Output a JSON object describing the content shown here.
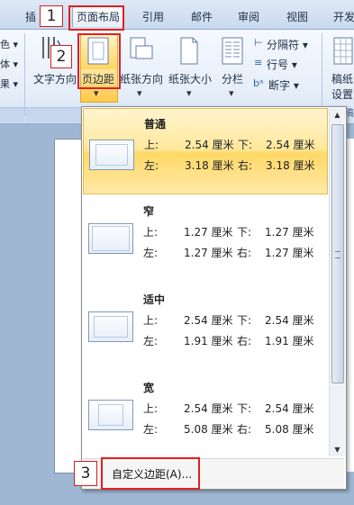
{
  "tabs": [
    {
      "label": "插",
      "active": false
    },
    {
      "label": "页面布局",
      "active": true
    },
    {
      "label": "引用",
      "active": false
    },
    {
      "label": "邮件",
      "active": false
    },
    {
      "label": "审阅",
      "active": false
    },
    {
      "label": "视图",
      "active": false
    },
    {
      "label": "开发",
      "active": false
    }
  ],
  "ribbon": {
    "left_labels": [
      "色 ▾",
      "体 ▾",
      "果 ▾"
    ],
    "text_direction": "文字方向",
    "margins": "页边距",
    "orientation": "纸张方向",
    "size": "纸张大小",
    "columns": "分栏",
    "breaks": "分隔符 ▾",
    "line_numbers": "行号 ▾",
    "hyphenation": "断字 ▾",
    "draft_line1": "稿纸",
    "draft_line2": "设置",
    "draft_group": "稿"
  },
  "margin_presets": [
    {
      "name": "普通",
      "top_label": "上:",
      "top": "2.54 厘米",
      "bottom_label": "下:",
      "bottom": "2.54 厘米",
      "left_label": "左:",
      "left": "3.18 厘米",
      "right_label": "右:",
      "right": "3.18 厘米",
      "selected": true
    },
    {
      "name": "窄",
      "top_label": "上:",
      "top": "1.27 厘米",
      "bottom_label": "下:",
      "bottom": "1.27 厘米",
      "left_label": "左:",
      "left": "1.27 厘米",
      "right_label": "右:",
      "right": "1.27 厘米",
      "selected": false
    },
    {
      "name": "适中",
      "top_label": "上:",
      "top": "2.54 厘米",
      "bottom_label": "下:",
      "bottom": "2.54 厘米",
      "left_label": "左:",
      "left": "1.91 厘米",
      "right_label": "右:",
      "right": "1.91 厘米",
      "selected": false
    },
    {
      "name": "宽",
      "top_label": "上:",
      "top": "2.54 厘米",
      "bottom_label": "下:",
      "bottom": "2.54 厘米",
      "left_label": "左:",
      "left": "5.08 厘米",
      "right_label": "右:",
      "right": "5.08 厘米",
      "selected": false
    }
  ],
  "custom_margins": "自定义边距(A)...",
  "annotations": [
    "1",
    "2",
    "3"
  ],
  "colors": {
    "selected_bg": "#ffe08a",
    "annotation_red": "#e02020",
    "ribbon_bg": "#e4edf8"
  }
}
